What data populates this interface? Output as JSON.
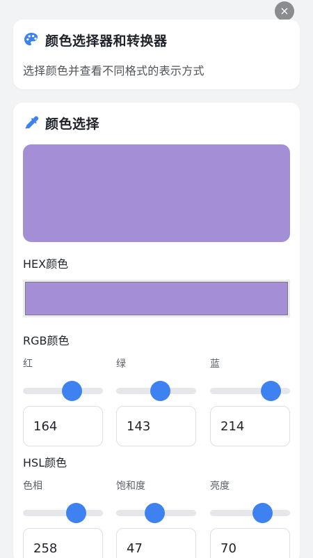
{
  "header": {
    "title": "颜色选择器和转换器",
    "subtitle": "选择颜色并查看不同格式的表示方式",
    "icon": "palette-icon"
  },
  "close": {
    "icon": "close-icon",
    "label": "×"
  },
  "picker": {
    "title": "颜色选择",
    "icon": "eyedropper-icon",
    "preview_color": "#a48fd6"
  },
  "hex": {
    "label": "HEX颜色",
    "color": "#a48fd6"
  },
  "rgb": {
    "label": "RGB颜色",
    "channels": [
      {
        "label": "红",
        "value": "164",
        "fraction": 0.6431
      },
      {
        "label": "绿",
        "value": "143",
        "fraction": 0.5608
      },
      {
        "label": "蓝",
        "value": "214",
        "fraction": 0.8392
      }
    ]
  },
  "hsl": {
    "label": "HSL颜色",
    "channels": [
      {
        "label": "色相",
        "value": "258",
        "fraction": 0.7167
      },
      {
        "label": "饱和度",
        "value": "47",
        "fraction": 0.47
      },
      {
        "label": "亮度",
        "value": "70",
        "fraction": 0.7
      }
    ]
  },
  "colors": {
    "accent": "#3d82f0",
    "background": "#f2f3f5"
  }
}
